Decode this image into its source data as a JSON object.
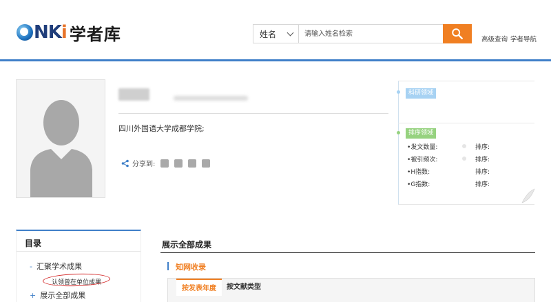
{
  "header": {
    "logo_latin": "CNKI",
    "logo_cn": "学者库",
    "search": {
      "field_value": "姓名",
      "placeholder": "请输入姓名检索"
    },
    "links": [
      "高级查询",
      "学者导航"
    ]
  },
  "profile": {
    "affiliation": "四川外国语大学成都学院;",
    "share_label": "分享到:"
  },
  "side_note": {
    "research_tag": "科研领域",
    "ranking_tag": "排序领域",
    "stats": [
      {
        "label": "发文数量:",
        "rank_label": "排序:"
      },
      {
        "label": "被引频次:",
        "rank_label": "排序:"
      },
      {
        "label": "H指数:",
        "rank_label": "排序:"
      },
      {
        "label": "G指数:",
        "rank_label": "排序:"
      }
    ]
  },
  "toc": {
    "title": "目录",
    "items": [
      {
        "prefix": "-",
        "label": "汇聚学术成果"
      },
      {
        "label": "认领曾在单位成果"
      },
      {
        "prefix": "+",
        "label": "展示全部成果"
      }
    ]
  },
  "main": {
    "title": "展示全部成果",
    "source_label": "知网收录",
    "tabs": [
      "按发表年度",
      "按文献类型"
    ]
  },
  "colors": {
    "accent_orange": "#f07f22",
    "accent_blue": "#3f7fc8",
    "tag_blue": "#a7d2f3",
    "tag_green": "#96d27f",
    "annotation_red": "#d42a2a"
  }
}
